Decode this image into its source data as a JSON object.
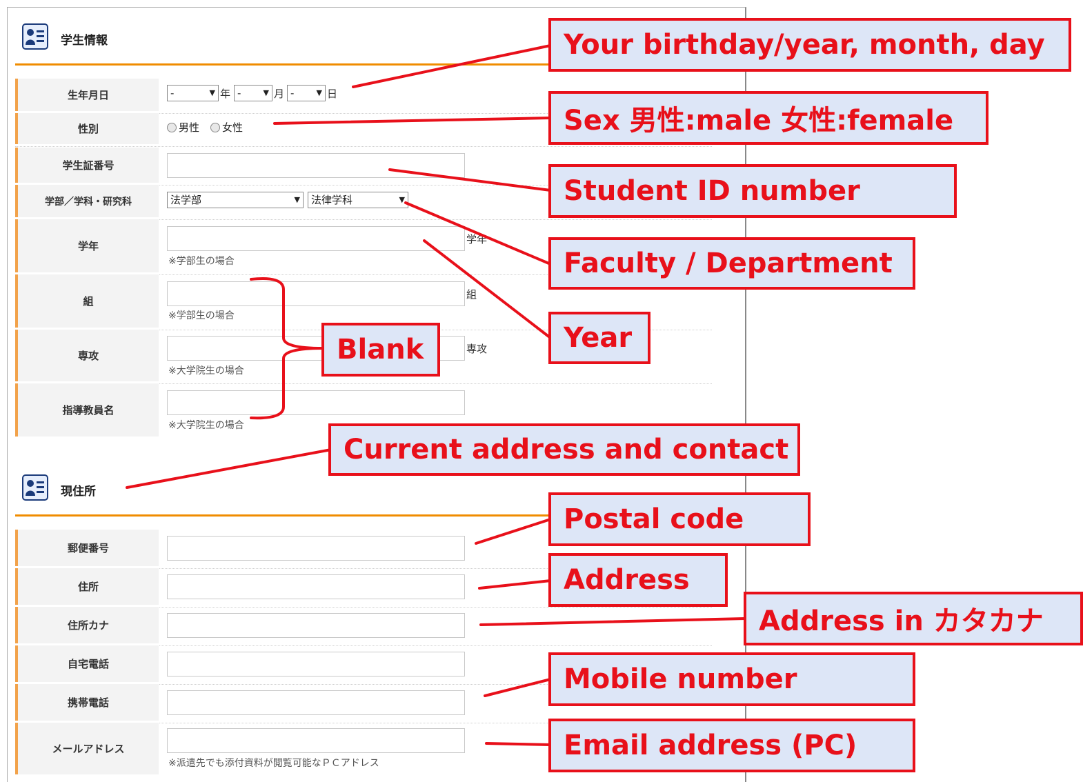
{
  "sections": {
    "student_info": {
      "title": "学生情報"
    },
    "current_address": {
      "title": "現住所"
    }
  },
  "student_fields": {
    "birthday": {
      "label": "生年月日",
      "year_value": "-",
      "year_unit": "年",
      "month_value": "-",
      "month_unit": "月",
      "day_value": "-",
      "day_unit": "日"
    },
    "sex": {
      "label": "性別",
      "option_male": "男性",
      "option_female": "女性"
    },
    "student_id": {
      "label": "学生証番号",
      "value": ""
    },
    "faculty": {
      "label": "学部／学科・研究科",
      "faculty_value": "法学部",
      "department_value": "法律学科"
    },
    "year": {
      "label": "学年",
      "unit": "学年",
      "note": "※学部生の場合",
      "value": ""
    },
    "group": {
      "label": "組",
      "unit": "組",
      "note": "※学部生の場合",
      "value": ""
    },
    "major": {
      "label": "専攻",
      "unit": "専攻",
      "note": "※大学院生の場合",
      "value": ""
    },
    "advisor": {
      "label": "指導教員名",
      "note": "※大学院生の場合",
      "value": ""
    }
  },
  "address_fields": {
    "postal_code": {
      "label": "郵便番号",
      "value": ""
    },
    "address": {
      "label": "住所",
      "value": ""
    },
    "address_kana": {
      "label": "住所カナ",
      "value": ""
    },
    "home_phone": {
      "label": "自宅電話",
      "value": ""
    },
    "mobile_phone": {
      "label": "携帯電話",
      "value": ""
    },
    "email": {
      "label": "メールアドレス",
      "note": "※派遣先でも添付資料が閲覧可能なＰＣアドレス",
      "value": ""
    }
  },
  "callouts": {
    "birthday": "Your birthday/year, month, day",
    "sex": "Sex 男性:male  女性:female",
    "student_id": "Student ID number",
    "faculty": "Faculty / Department",
    "year": "Year",
    "blank": "Blank",
    "current_address": "Current address and contact",
    "postal_code": "Postal code",
    "address": "Address",
    "address_kana": "Address in カタカナ",
    "mobile": "Mobile number",
    "email": "Email address (PC)"
  },
  "colors": {
    "callout_border": "#e8101a",
    "callout_fill": "#dde6f7",
    "section_rule": "#f08c00",
    "label_accent": "#f2a24a"
  },
  "icons": {
    "section_icon": "profile-card-icon"
  }
}
